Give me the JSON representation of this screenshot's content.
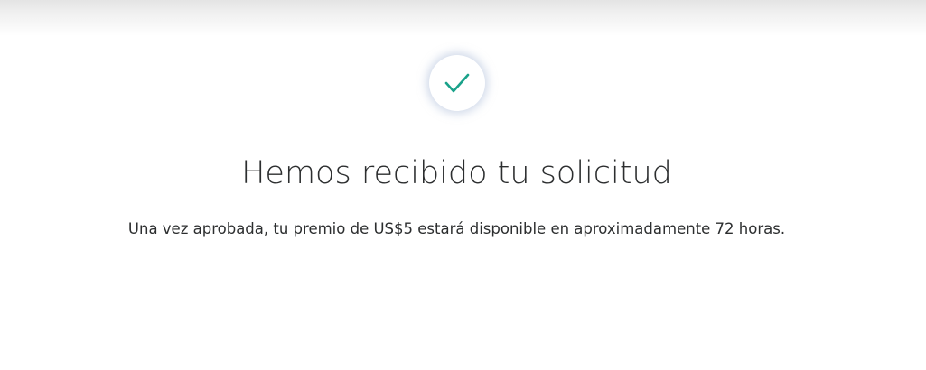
{
  "confirmation": {
    "icon": "checkmark-icon",
    "icon_color": "#1aa28a",
    "title": "Hemos recibido tu solicitud",
    "message": "Una vez aprobada, tu premio de US$5 estará disponible en aproximadamente 72 horas."
  }
}
